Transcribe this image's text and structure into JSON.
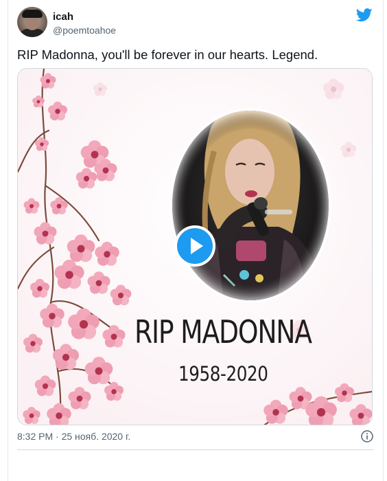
{
  "tweet": {
    "author_name": "icah",
    "author_handle": "@poemtoahoe",
    "text": "RIP Madonna, you'll be forever in our hearts. Legend.",
    "timestamp": "8:32 PM · 25 нояб. 2020 г."
  },
  "media": {
    "type": "video",
    "overlay_title": "RIP MADONNA",
    "overlay_years": "1958-2020"
  },
  "icons": {
    "brand": "twitter-bird-icon",
    "play": "play-icon",
    "info": "info-icon"
  },
  "colors": {
    "accent": "#1d9bf0",
    "text": "#0f1419",
    "muted": "#536471",
    "blossom": "#e98aa3"
  }
}
